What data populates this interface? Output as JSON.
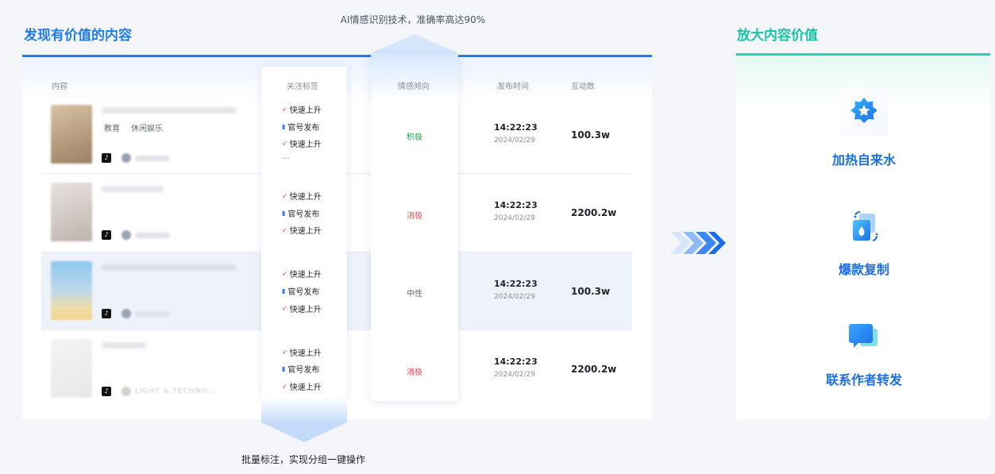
{
  "left": {
    "title": "发现有价值的内容",
    "top_caption": "AI情感识别技术，准确率高达90%",
    "bottom_caption": "批量标注，实现分组一键操作",
    "columns": {
      "content": "内容",
      "tags": "关注标签",
      "sentiment": "情感倾向",
      "time": "发布时间",
      "engagement": "互动数"
    },
    "rows": [
      {
        "categories": [
          "教育",
          "休闲娱乐"
        ],
        "tags": [
          {
            "icon": "rocket-icon",
            "label": "快速上升"
          },
          {
            "icon": "official-icon",
            "label": "官号发布"
          },
          {
            "icon": "rocket-icon",
            "label": "快速上升"
          }
        ],
        "more": "...",
        "sentiment": "积极",
        "time": "14:22:23",
        "date": "2024/02/29",
        "engagement": "100.3w"
      },
      {
        "categories": [],
        "tags": [
          {
            "icon": "rocket-icon",
            "label": "快速上升"
          },
          {
            "icon": "official-icon",
            "label": "官号发布"
          },
          {
            "icon": "rocket-icon",
            "label": "快速上升"
          }
        ],
        "more": "",
        "sentiment": "消极",
        "time": "14:22:23",
        "date": "2024/02/29",
        "engagement": "2200.2w"
      },
      {
        "categories": [],
        "tags": [
          {
            "icon": "rocket-icon",
            "label": "快速上升"
          },
          {
            "icon": "official-icon",
            "label": "官号发布"
          },
          {
            "icon": "rocket-icon",
            "label": "快速上升"
          }
        ],
        "more": "",
        "sentiment": "中性",
        "time": "14:22:23",
        "date": "2024/02/29",
        "engagement": "100.3w"
      },
      {
        "categories": [],
        "author_text": "LIGHT & TECHNO...",
        "tags": [
          {
            "icon": "rocket-icon",
            "label": "快速上升"
          },
          {
            "icon": "official-icon",
            "label": "官号发布"
          },
          {
            "icon": "rocket-icon",
            "label": "快速上升"
          }
        ],
        "more": "",
        "sentiment": "消极",
        "time": "14:22:23",
        "date": "2024/02/29",
        "engagement": "2200.2w"
      }
    ]
  },
  "right": {
    "title": "放大内容价值",
    "features": [
      {
        "icon": "star-badge-icon",
        "label": "加热自来水"
      },
      {
        "icon": "copy-refresh-icon",
        "label": "爆款复制"
      },
      {
        "icon": "chat-bubble-icon",
        "label": "联系作者转发"
      }
    ]
  },
  "colors": {
    "accent_blue": "#1e7cf2",
    "accent_teal": "#17c4a6",
    "positive": "#1eaa52",
    "negative": "#f0474c",
    "neutral": "#646a73"
  }
}
